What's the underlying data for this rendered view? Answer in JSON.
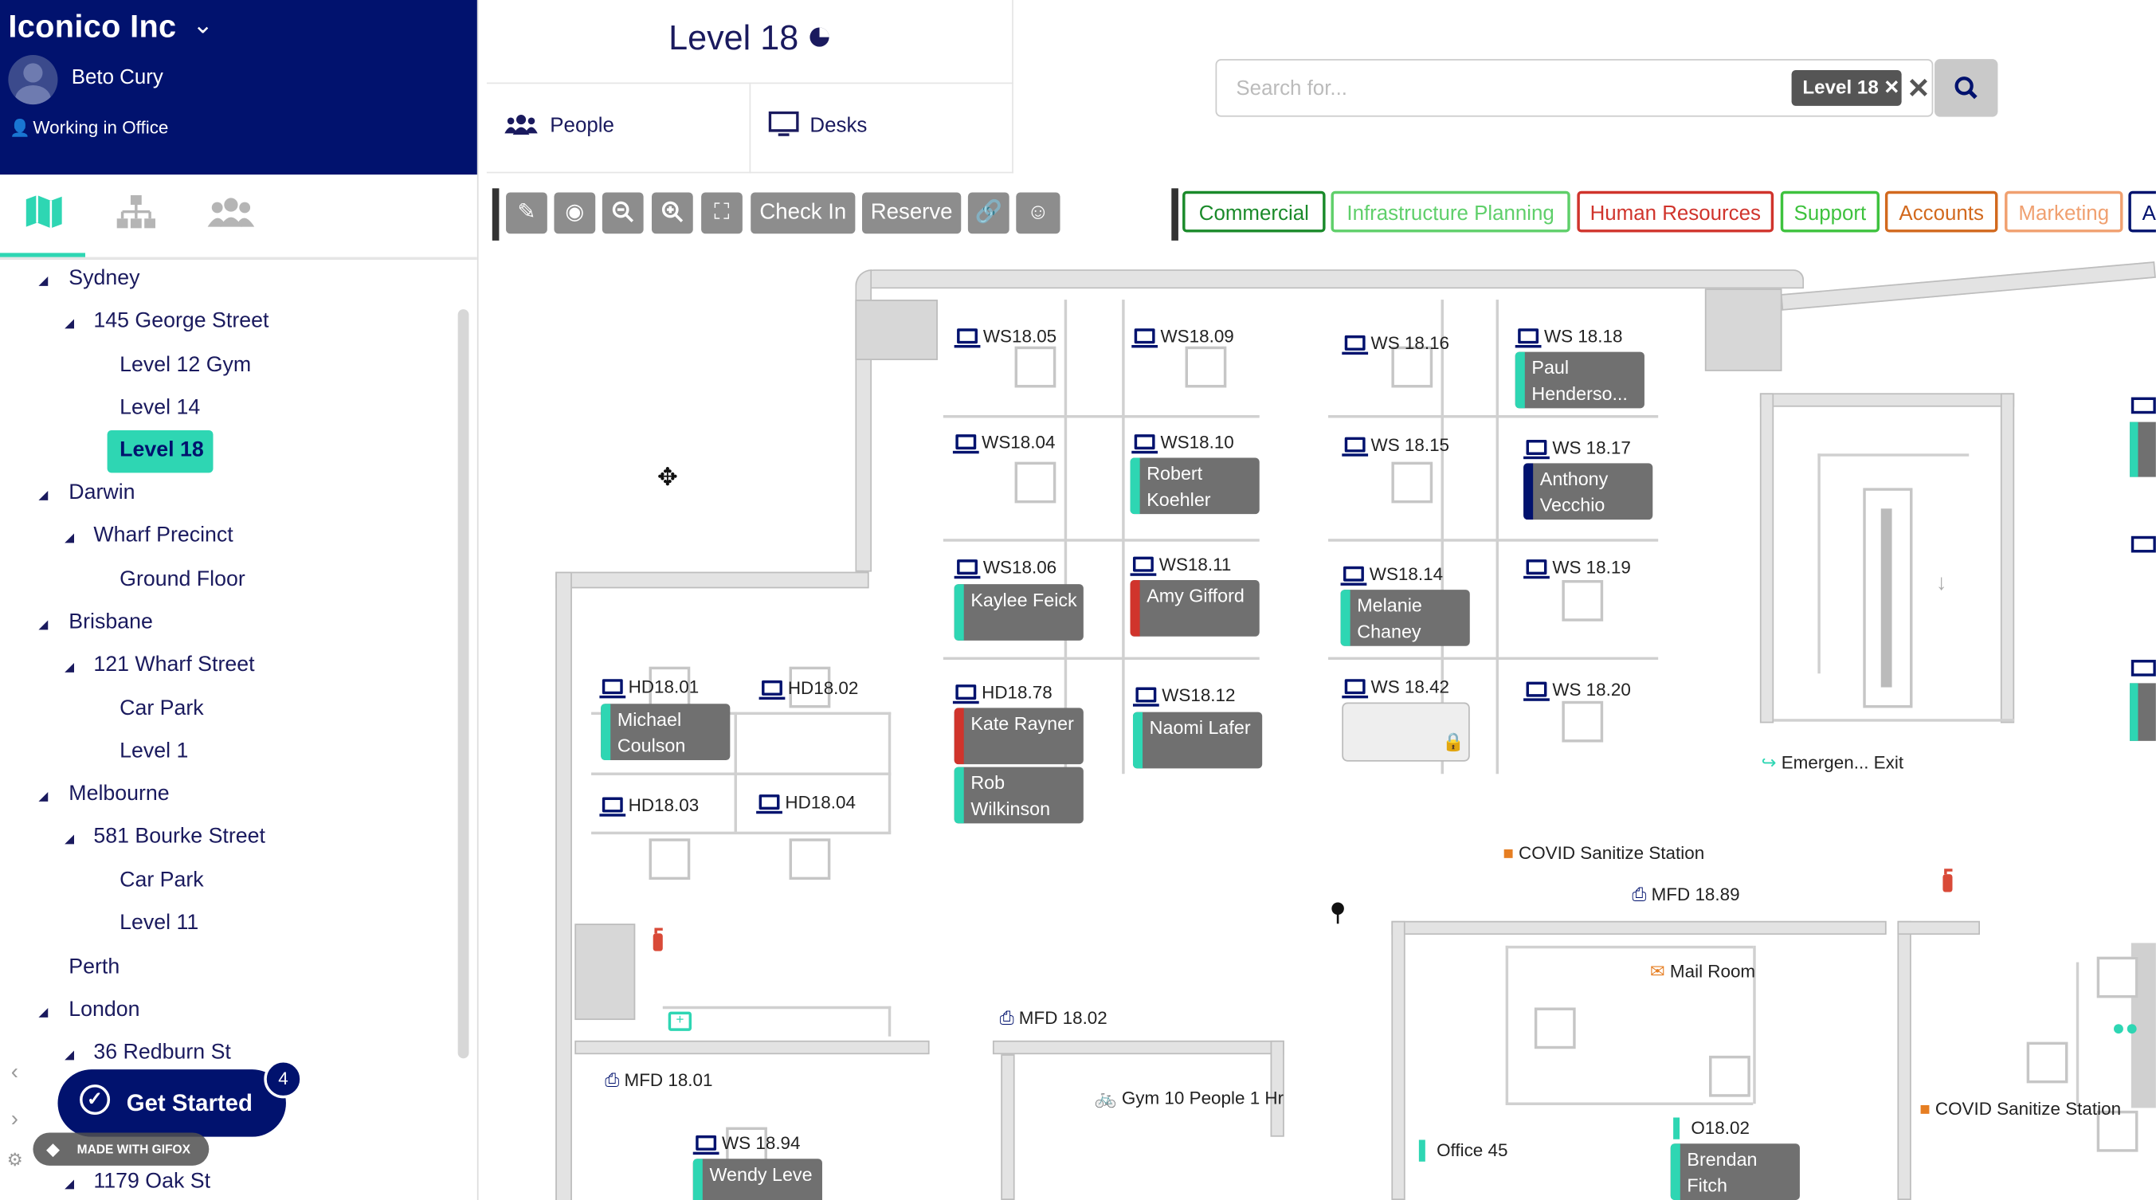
{
  "org": {
    "name": "Iconico Inc",
    "user": "Beto Cury",
    "status": "Working in Office"
  },
  "tree": [
    {
      "label": "Sydney"
    },
    {
      "label": "145 George Street"
    },
    {
      "label": "Level 12 Gym"
    },
    {
      "label": "Level 14"
    },
    {
      "label": "Level 18"
    },
    {
      "label": "Darwin"
    },
    {
      "label": "Wharf Precinct"
    },
    {
      "label": "Ground Floor"
    },
    {
      "label": "Brisbane"
    },
    {
      "label": "121 Wharf Street"
    },
    {
      "label": "Car Park"
    },
    {
      "label": "Level 1"
    },
    {
      "label": "Melbourne"
    },
    {
      "label": "581 Bourke Street"
    },
    {
      "label": "Car Park"
    },
    {
      "label": "Level 11"
    },
    {
      "label": "Perth"
    },
    {
      "label": "London"
    },
    {
      "label": "36 Redburn St"
    },
    {
      "label": "1179 Oak St"
    }
  ],
  "get_started": {
    "label": "Get Started",
    "badge": "4"
  },
  "gifox": "MADE WITH GIFOX",
  "header": {
    "title": "Level 18",
    "tabs": [
      "People",
      "Desks"
    ]
  },
  "search": {
    "placeholder": "Search for...",
    "chip": "Level 18"
  },
  "toolbar": {
    "check_in": "Check In",
    "reserve": "Reserve"
  },
  "departments": [
    {
      "label": "Commercial",
      "color": "#1a8a2a"
    },
    {
      "label": "Infrastructure Planning",
      "color": "#5fcf6a"
    },
    {
      "label": "Human Resources",
      "color": "#d0342c"
    },
    {
      "label": "Support",
      "color": "#3ec23e"
    },
    {
      "label": "Accounts",
      "color": "#d2691e"
    },
    {
      "label": "Marketing",
      "color": "#f0a070"
    },
    {
      "label": "A",
      "color": "#01126e"
    }
  ],
  "workstations": [
    {
      "label": "WS18.05"
    },
    {
      "label": "WS18.09"
    },
    {
      "label": "WS 18.16"
    },
    {
      "label": "WS 18.18"
    },
    {
      "label": "WS18.04"
    },
    {
      "label": "WS18.10"
    },
    {
      "label": "WS 18.15"
    },
    {
      "label": "WS 18.17"
    },
    {
      "label": "WS18.06"
    },
    {
      "label": "WS18.11"
    },
    {
      "label": "WS18.14"
    },
    {
      "label": "WS 18.19"
    },
    {
      "label": "HD18.01"
    },
    {
      "label": "HD18.02"
    },
    {
      "label": "HD18.78"
    },
    {
      "label": "WS18.12"
    },
    {
      "label": "WS 18.42"
    },
    {
      "label": "WS 18.20"
    },
    {
      "label": "HD18.03"
    },
    {
      "label": "HD18.04"
    },
    {
      "label": "WS 18.94"
    }
  ],
  "people": [
    {
      "name": "Paul Henderso...",
      "color": "#2ed6b3"
    },
    {
      "name": "Robert Koehler",
      "color": "#2ed6b3"
    },
    {
      "name": "Anthony Vecchio",
      "color": "#01126e"
    },
    {
      "name": "Kaylee Feick",
      "color": "#2ed6b3"
    },
    {
      "name": "Amy Gifford",
      "color": "#d0342c"
    },
    {
      "name": "Melanie Chaney",
      "color": "#2ed6b3"
    },
    {
      "name": "Michael Coulson",
      "color": "#2ed6b3"
    },
    {
      "name": "Kate Rayner",
      "color": "#d0342c"
    },
    {
      "name": "Naomi Lafer",
      "color": "#2ed6b3"
    },
    {
      "name": "Rob Wilkinson",
      "color": "#2ed6b3"
    },
    {
      "name": "Wendy Leve",
      "color": "#2ed6b3"
    },
    {
      "name": "Brendan Fitch",
      "color": "#2ed6b3"
    }
  ],
  "pois": {
    "emergency": "Emergen... Exit",
    "covid1": "COVID Sanitize Station",
    "mfd1889": "MFD 18.89",
    "mail": "Mail Room",
    "mfd1802": "MFD 18.02",
    "mfd1801": "MFD 18.01",
    "gym": "Gym 10 People 1 Hr",
    "office45": "Office 45",
    "o1802": "O18.02",
    "covid2": "COVID Sanitize Station"
  }
}
